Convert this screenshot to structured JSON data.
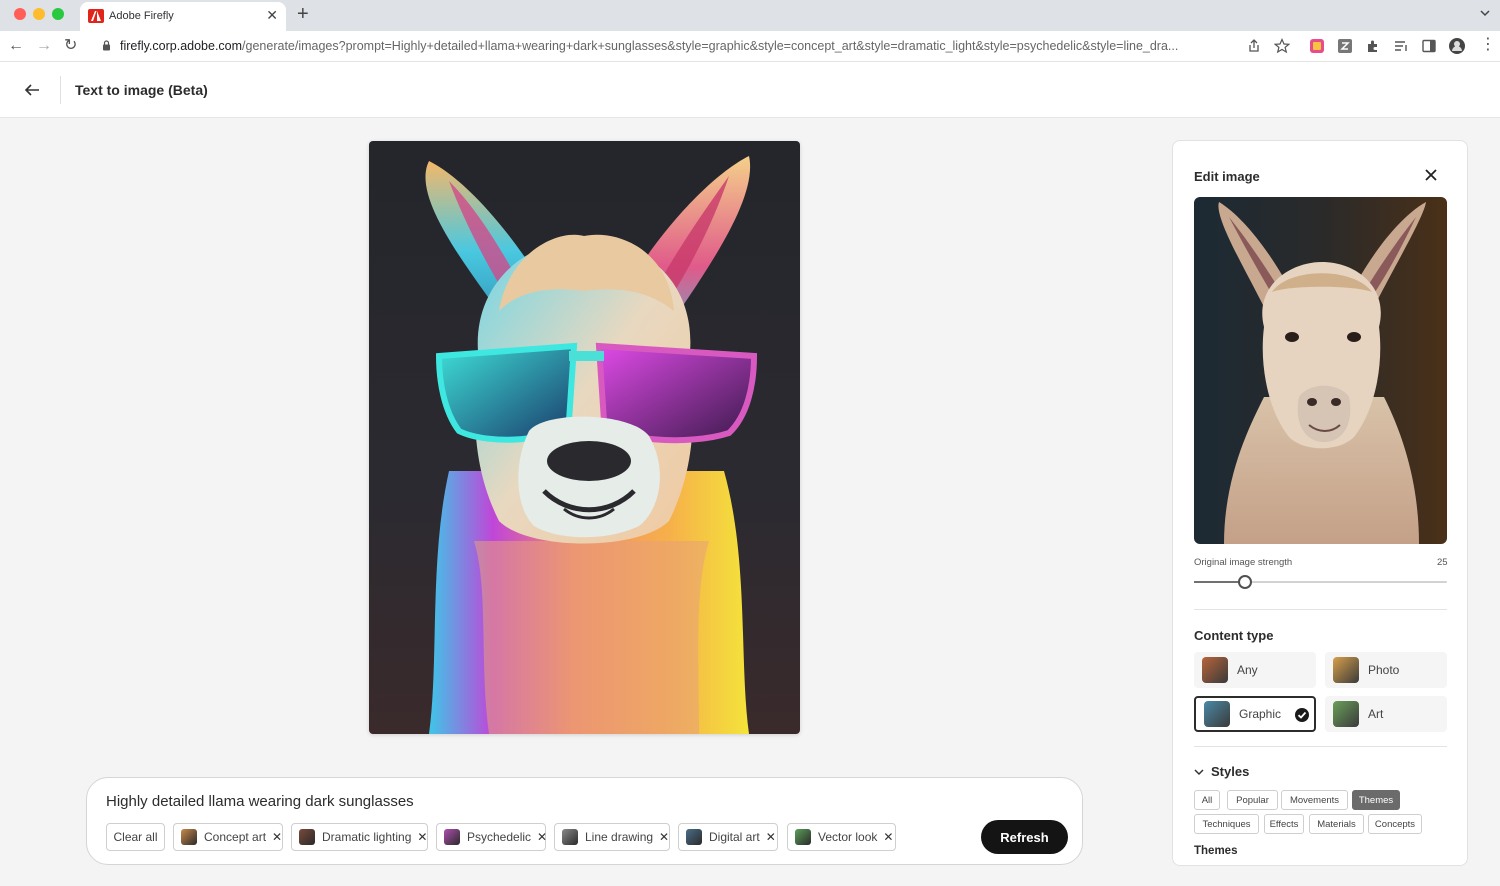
{
  "browser": {
    "tab_title": "Adobe Firefly",
    "url_host": "firefly.corp.adobe.com",
    "url_path": "/generate/images?prompt=Highly+detailed+llama+wearing+dark+sunglasses&style=graphic&style=concept_art&style=dramatic_light&style=psychedelic&style=line_dra..."
  },
  "header": {
    "title": "Text to image (Beta)"
  },
  "prompt": {
    "text": "Highly detailed llama wearing dark sunglasses",
    "clear_label": "Clear all",
    "chips": [
      {
        "label": "Concept art",
        "color": "#c98a4a"
      },
      {
        "label": "Dramatic lighting",
        "color": "#7a4a3a"
      },
      {
        "label": "Psychedelic",
        "color": "#b04fb0"
      },
      {
        "label": "Line drawing",
        "color": "#8a8a8a"
      },
      {
        "label": "Digital art",
        "color": "#4a6e8a"
      },
      {
        "label": "Vector look",
        "color": "#5aa05a"
      }
    ],
    "refresh_label": "Refresh"
  },
  "panel": {
    "title": "Edit image",
    "strength_label": "Original image strength",
    "strength_value": "25",
    "strength_fraction": 0.2,
    "content_type_title": "Content type",
    "content_types": [
      {
        "label": "Any",
        "color": "#b8643a",
        "selected": false
      },
      {
        "label": "Photo",
        "color": "#d8a04a",
        "selected": false
      },
      {
        "label": "Graphic",
        "color": "#4a8aa8",
        "selected": true
      },
      {
        "label": "Art",
        "color": "#6aa05a",
        "selected": false
      }
    ],
    "styles_title": "Styles",
    "style_chips": [
      {
        "label": "All",
        "active": false
      },
      {
        "label": "Popular",
        "active": false
      },
      {
        "label": "Movements",
        "active": false
      },
      {
        "label": "Themes",
        "active": true
      },
      {
        "label": "Techniques",
        "active": false
      },
      {
        "label": "Effects",
        "active": false
      },
      {
        "label": "Materials",
        "active": false
      },
      {
        "label": "Concepts",
        "active": false
      }
    ],
    "themes_label": "Themes"
  }
}
